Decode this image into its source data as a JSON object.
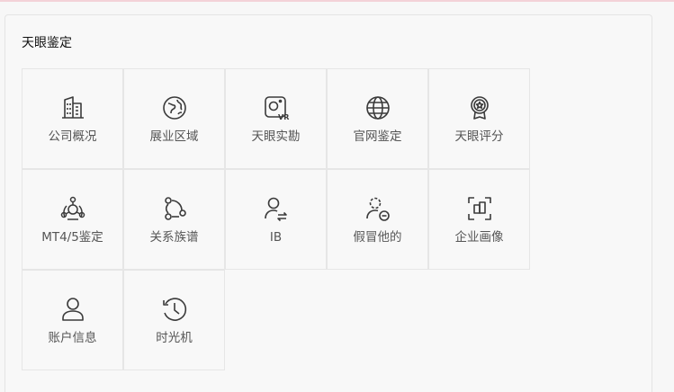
{
  "section": {
    "title": "天眼鉴定"
  },
  "tiles": [
    {
      "label": "公司概况",
      "icon": "building-icon"
    },
    {
      "label": "展业区域",
      "icon": "globe-map-icon"
    },
    {
      "label": "天眼实勘",
      "icon": "vr-camera-icon"
    },
    {
      "label": "官网鉴定",
      "icon": "web-globe-icon"
    },
    {
      "label": "天眼评分",
      "icon": "award-medal-icon"
    },
    {
      "label": "MT4/5鉴定",
      "icon": "network-group-icon"
    },
    {
      "label": "关系族谱",
      "icon": "relation-graph-icon"
    },
    {
      "label": "IB",
      "icon": "user-exchange-icon"
    },
    {
      "label": "假冒他的",
      "icon": "user-minus-icon"
    },
    {
      "label": "企业画像",
      "icon": "scan-frame-icon"
    },
    {
      "label": "账户信息",
      "icon": "user-account-icon"
    },
    {
      "label": "时光机",
      "icon": "history-clock-icon"
    }
  ],
  "colors": {
    "icon_stroke": "#3a3a3a",
    "tile_border": "#e6e6e6",
    "label": "#555555"
  }
}
